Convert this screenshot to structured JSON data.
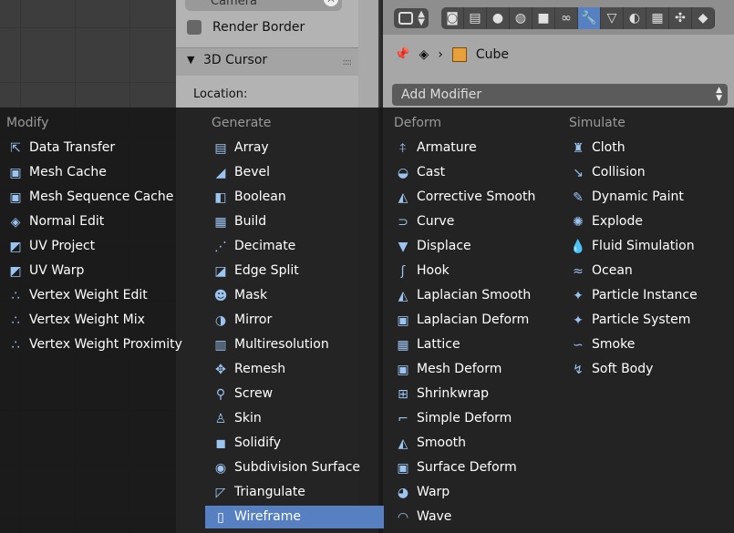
{
  "properties": {
    "camera_label": "Camera",
    "render_border_label": "Render Border",
    "cursor_panel_title": "3D Cursor",
    "location_label": "Location:"
  },
  "buttons_header": {
    "breadcrumb_object": "Cube",
    "add_modifier_label": "Add Modifier"
  },
  "menu": {
    "columns": [
      {
        "title": "Modify",
        "items": [
          {
            "label": "Data Transfer",
            "icon": "data-transfer-icon"
          },
          {
            "label": "Mesh Cache",
            "icon": "mesh-cache-icon"
          },
          {
            "label": "Mesh Sequence Cache",
            "icon": "mesh-sequence-cache-icon"
          },
          {
            "label": "Normal Edit",
            "icon": "normal-edit-icon"
          },
          {
            "label": "UV Project",
            "icon": "uv-project-icon"
          },
          {
            "label": "UV Warp",
            "icon": "uv-warp-icon"
          },
          {
            "label": "Vertex Weight Edit",
            "icon": "vertex-weight-icon"
          },
          {
            "label": "Vertex Weight Mix",
            "icon": "vertex-weight-icon"
          },
          {
            "label": "Vertex Weight Proximity",
            "icon": "vertex-weight-icon"
          }
        ]
      },
      {
        "title": "Generate",
        "items": [
          {
            "label": "Array",
            "icon": "array-icon"
          },
          {
            "label": "Bevel",
            "icon": "bevel-icon"
          },
          {
            "label": "Boolean",
            "icon": "boolean-icon"
          },
          {
            "label": "Build",
            "icon": "build-icon"
          },
          {
            "label": "Decimate",
            "icon": "decimate-icon"
          },
          {
            "label": "Edge Split",
            "icon": "edge-split-icon"
          },
          {
            "label": "Mask",
            "icon": "mask-icon"
          },
          {
            "label": "Mirror",
            "icon": "mirror-icon"
          },
          {
            "label": "Multiresolution",
            "icon": "multiresolution-icon"
          },
          {
            "label": "Remesh",
            "icon": "remesh-icon"
          },
          {
            "label": "Screw",
            "icon": "screw-icon"
          },
          {
            "label": "Skin",
            "icon": "skin-icon"
          },
          {
            "label": "Solidify",
            "icon": "solidify-icon"
          },
          {
            "label": "Subdivision Surface",
            "icon": "subdivision-surface-icon"
          },
          {
            "label": "Triangulate",
            "icon": "triangulate-icon"
          },
          {
            "label": "Wireframe",
            "icon": "wireframe-icon",
            "selected": true
          }
        ]
      },
      {
        "title": "Deform",
        "items": [
          {
            "label": "Armature",
            "icon": "armature-icon"
          },
          {
            "label": "Cast",
            "icon": "cast-icon"
          },
          {
            "label": "Corrective Smooth",
            "icon": "smooth-icon"
          },
          {
            "label": "Curve",
            "icon": "curve-icon"
          },
          {
            "label": "Displace",
            "icon": "displace-icon"
          },
          {
            "label": "Hook",
            "icon": "hook-icon"
          },
          {
            "label": "Laplacian Smooth",
            "icon": "smooth-icon"
          },
          {
            "label": "Laplacian Deform",
            "icon": "deform-icon"
          },
          {
            "label": "Lattice",
            "icon": "lattice-icon"
          },
          {
            "label": "Mesh Deform",
            "icon": "deform-icon"
          },
          {
            "label": "Shrinkwrap",
            "icon": "shrinkwrap-icon"
          },
          {
            "label": "Simple Deform",
            "icon": "simple-deform-icon"
          },
          {
            "label": "Smooth",
            "icon": "smooth-icon"
          },
          {
            "label": "Surface Deform",
            "icon": "deform-icon"
          },
          {
            "label": "Warp",
            "icon": "warp-icon"
          },
          {
            "label": "Wave",
            "icon": "wave-icon"
          }
        ]
      },
      {
        "title": "Simulate",
        "items": [
          {
            "label": "Cloth",
            "icon": "cloth-icon"
          },
          {
            "label": "Collision",
            "icon": "collision-icon"
          },
          {
            "label": "Dynamic Paint",
            "icon": "dynamic-paint-icon"
          },
          {
            "label": "Explode",
            "icon": "explode-icon"
          },
          {
            "label": "Fluid Simulation",
            "icon": "fluid-icon"
          },
          {
            "label": "Ocean",
            "icon": "ocean-icon"
          },
          {
            "label": "Particle Instance",
            "icon": "particles-icon"
          },
          {
            "label": "Particle System",
            "icon": "particles-icon"
          },
          {
            "label": "Smoke",
            "icon": "smoke-icon"
          },
          {
            "label": "Soft Body",
            "icon": "soft-body-icon"
          }
        ]
      }
    ]
  },
  "colors": {
    "accent": "#5680c2",
    "menu_bg": "#181818",
    "menu_text": "#ffffff",
    "menu_header_text": "#9a9a9a"
  }
}
